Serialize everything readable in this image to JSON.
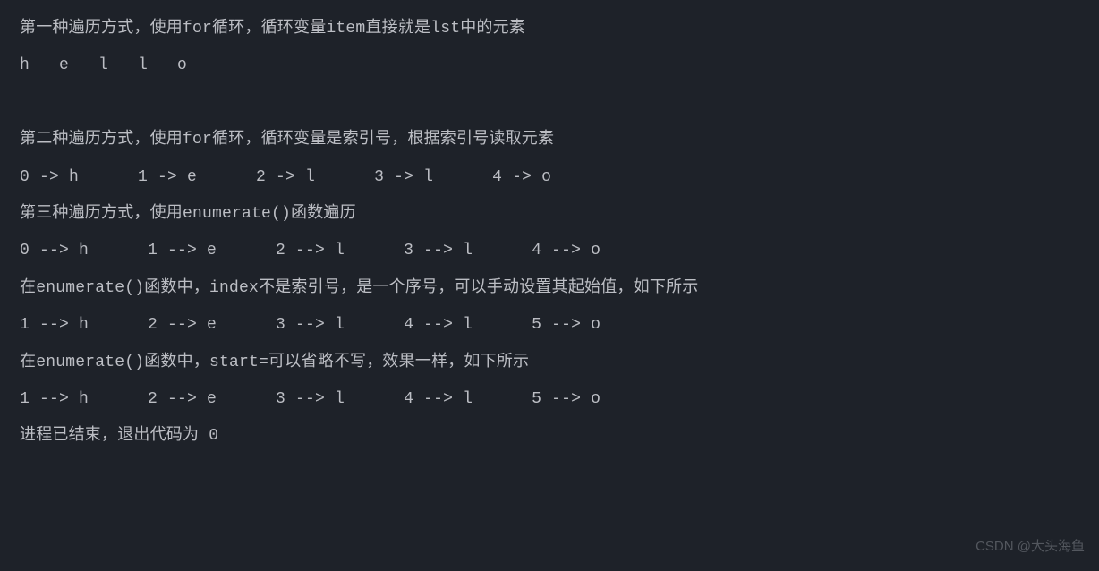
{
  "console": {
    "lines": [
      "第一种遍历方式，使用for循环，循环变量item直接就是lst中的元素",
      "h   e   l   l   o   ",
      "",
      "第二种遍历方式，使用for循环，循环变量是索引号，根据索引号读取元素",
      "0 -> h      1 -> e      2 -> l      3 -> l      4 -> o      ",
      "第三种遍历方式，使用enumerate()函数遍历",
      "0 --> h      1 --> e      2 --> l      3 --> l      4 --> o      ",
      "在enumerate()函数中，index不是索引号，是一个序号，可以手动设置其起始值，如下所示",
      "1 --> h      2 --> e      3 --> l      4 --> l      5 --> o      ",
      "在enumerate()函数中，start=可以省略不写，效果一样，如下所示",
      "1 --> h      2 --> e      3 --> l      4 --> l      5 --> o      ",
      "进程已结束，退出代码为 0"
    ]
  },
  "watermark": "CSDN @大头海鱼"
}
